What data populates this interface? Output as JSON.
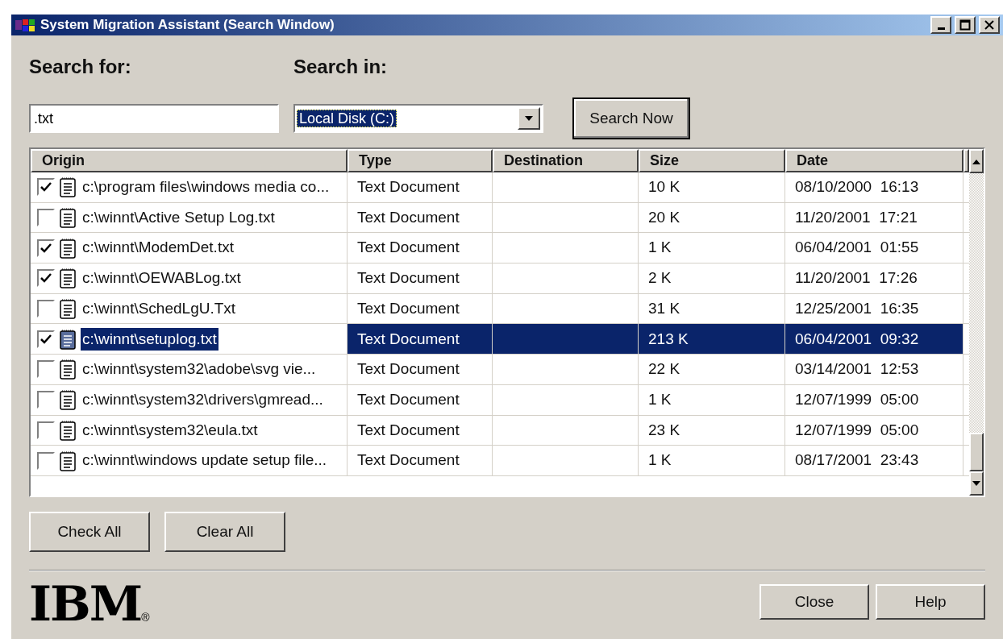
{
  "window": {
    "title": "System Migration Assistant (Search Window)"
  },
  "search_for": {
    "label": "Search for:",
    "value": ".txt"
  },
  "search_in": {
    "label": "Search in:",
    "value": "Local Disk (C:)"
  },
  "search_button": "Search Now",
  "table": {
    "columns": [
      "Origin",
      "Type",
      "Destination",
      "Size",
      "Date"
    ],
    "rows": [
      {
        "checked": true,
        "selected": false,
        "origin": "c:\\program files\\windows media co...",
        "type": "Text Document",
        "size": "10 K",
        "date": "08/10/2000  16:13"
      },
      {
        "checked": false,
        "selected": false,
        "origin": "c:\\winnt\\Active Setup Log.txt",
        "type": "Text Document",
        "size": "20 K",
        "date": "11/20/2001  17:21"
      },
      {
        "checked": true,
        "selected": false,
        "origin": "c:\\winnt\\ModemDet.txt",
        "type": "Text Document",
        "size": "1 K",
        "date": "06/04/2001  01:55"
      },
      {
        "checked": true,
        "selected": false,
        "origin": "c:\\winnt\\OEWABLog.txt",
        "type": "Text Document",
        "size": "2 K",
        "date": "11/20/2001  17:26"
      },
      {
        "checked": false,
        "selected": false,
        "origin": "c:\\winnt\\SchedLgU.Txt",
        "type": "Text Document",
        "size": "31 K",
        "date": "12/25/2001  16:35"
      },
      {
        "checked": true,
        "selected": true,
        "origin": "c:\\winnt\\setuplog.txt",
        "type": "Text Document",
        "size": "213 K",
        "date": "06/04/2001  09:32"
      },
      {
        "checked": false,
        "selected": false,
        "origin": "c:\\winnt\\system32\\adobe\\svg vie...",
        "type": "Text Document",
        "size": "22 K",
        "date": "03/14/2001  12:53"
      },
      {
        "checked": false,
        "selected": false,
        "origin": "c:\\winnt\\system32\\drivers\\gmread...",
        "type": "Text Document",
        "size": "1 K",
        "date": "12/07/1999  05:00"
      },
      {
        "checked": false,
        "selected": false,
        "origin": "c:\\winnt\\system32\\eula.txt",
        "type": "Text Document",
        "size": "23 K",
        "date": "12/07/1999  05:00"
      },
      {
        "checked": false,
        "selected": false,
        "origin": "c:\\winnt\\windows update setup file...",
        "type": "Text Document",
        "size": "1 K",
        "date": "08/17/2001  23:43"
      }
    ]
  },
  "list_buttons": [
    "Check All",
    "Clear All"
  ],
  "logo": {
    "text": "IBM",
    "mark": "®"
  },
  "footer_buttons": [
    "Close",
    "Help"
  ]
}
